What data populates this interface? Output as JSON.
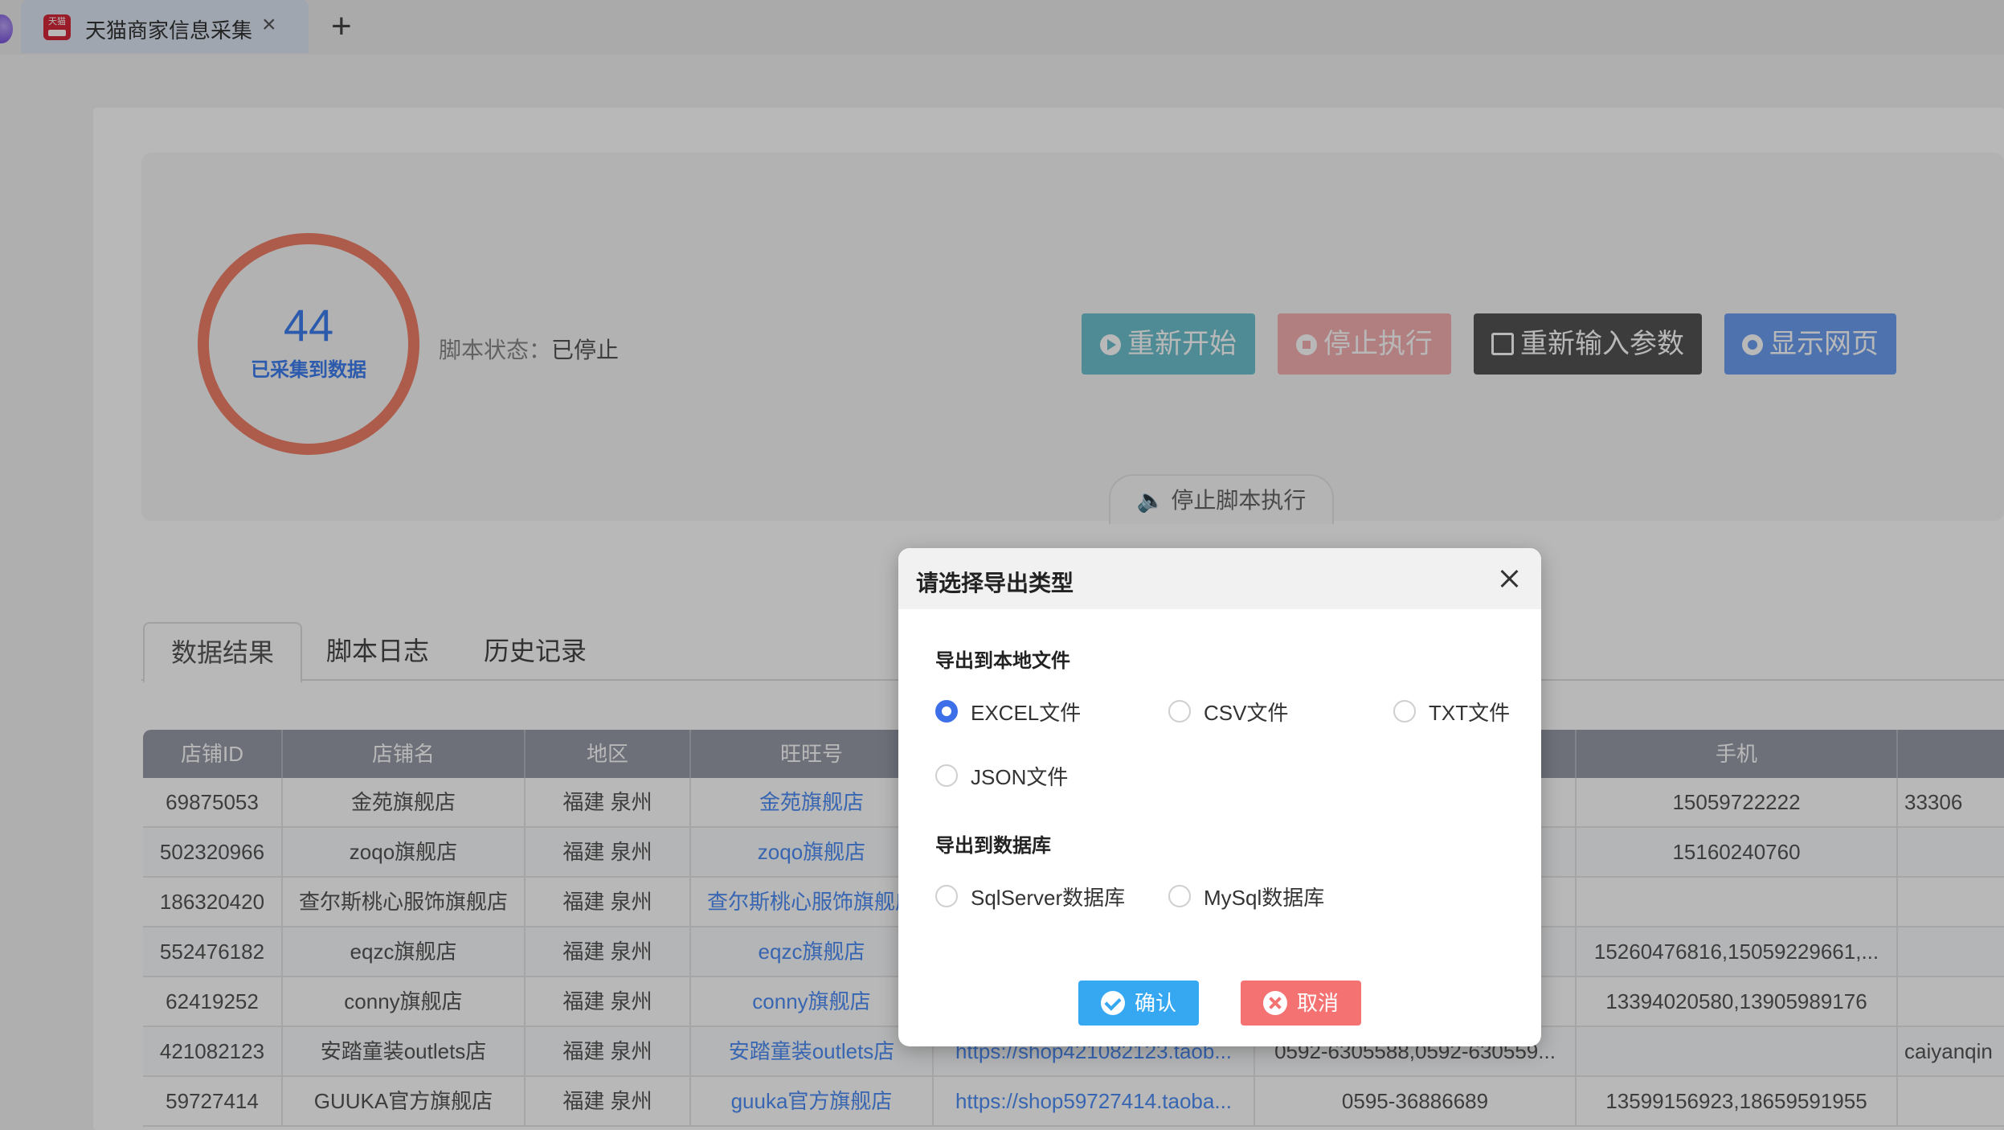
{
  "tab": {
    "title": "天猫商家信息采集",
    "favicon_text": "天猫",
    "close_glyph": "×",
    "add_glyph": "+"
  },
  "stats": {
    "count": "44",
    "count_label": "已采集到数据",
    "status_label": "脚本状态：",
    "status_value": "已停止"
  },
  "actions": {
    "restart": "重新开始",
    "stop": "停止执行",
    "reinput": "重新输入参数",
    "show_page": "显示网页",
    "stop_script": "停止脚本执行"
  },
  "tabs": {
    "results": "数据结果",
    "log": "脚本日志",
    "history": "历史记录"
  },
  "table": {
    "headers": [
      "店铺ID",
      "店铺名",
      "地区",
      "旺旺号",
      "",
      "",
      "手机",
      ""
    ],
    "rows": [
      [
        "69875053",
        "金苑旗舰店",
        "福建 泉州",
        "金苑旗舰店",
        "",
        "",
        "15059722222",
        "33306"
      ],
      [
        "502320966",
        "zoqo旗舰店",
        "福建 泉州",
        "zoqo旗舰店",
        "",
        "",
        "15160240760",
        ""
      ],
      [
        "186320420",
        "查尔斯桃心服饰旗舰店",
        "福建 泉州",
        "查尔斯桃心服饰旗舰店",
        "",
        "",
        "",
        ""
      ],
      [
        "552476182",
        "eqzc旗舰店",
        "福建 泉州",
        "eqzc旗舰店",
        "",
        "",
        "15260476816,15059229661,...",
        ""
      ],
      [
        "62419252",
        "conny旗舰店",
        "福建 泉州",
        "conny旗舰店",
        "",
        "",
        "13394020580,13905989176",
        ""
      ],
      [
        "421082123",
        "安踏童装outlets店",
        "福建 泉州",
        "安踏童装outlets店",
        "https://shop421082123.taob...",
        "0592-6305588,0592-630559...",
        "",
        "caiyanqin"
      ],
      [
        "59727414",
        "GUUKA官方旗舰店",
        "福建 泉州",
        "guuka官方旗舰店",
        "https://shop59727414.taoba...",
        "0595-36886689",
        "13599156923,18659591955",
        ""
      ]
    ]
  },
  "modal": {
    "title": "请选择导出类型",
    "local_section": "导出到本地文件",
    "options_local": [
      "EXCEL文件",
      "CSV文件",
      "TXT文件",
      "JSON文件"
    ],
    "db_section": "导出到数据库",
    "options_db": [
      "SqlServer数据库",
      "MySql数据库"
    ],
    "selected": "EXCEL文件",
    "confirm": "确认",
    "cancel": "取消"
  },
  "colors": {
    "accent": "#3c6fe8",
    "ring": "#f07f69",
    "confirm": "#36a8f2",
    "cancel": "#f47272"
  }
}
